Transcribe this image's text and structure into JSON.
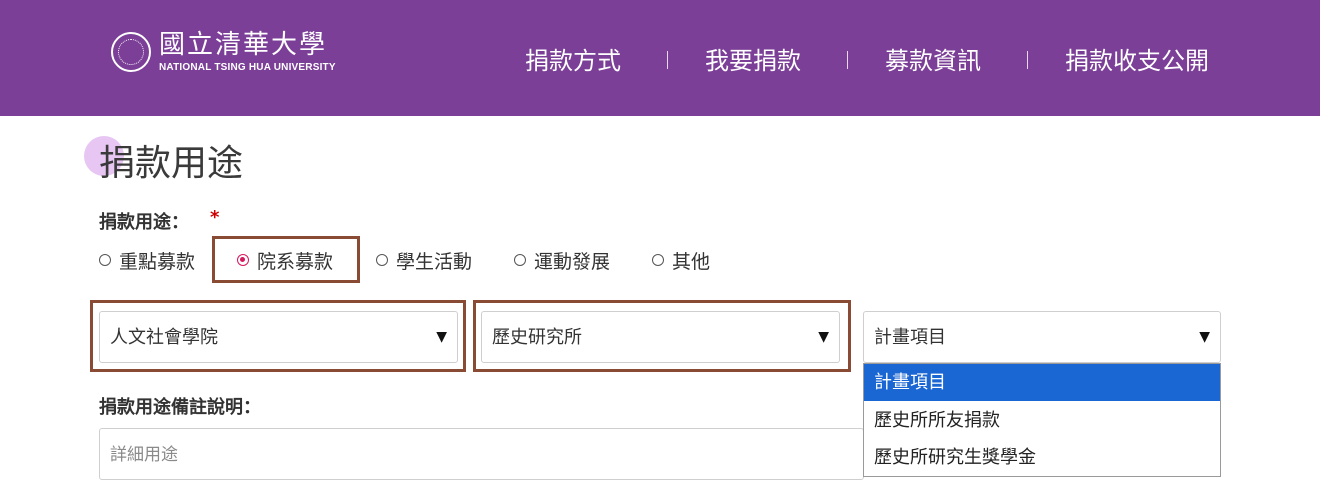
{
  "header": {
    "logo_cn": "國立清華大學",
    "logo_en": "NATIONAL TSING HUA UNIVERSITY",
    "bg_color": "#7b3f97",
    "nav": [
      {
        "label": "捐款方式"
      },
      {
        "label": "我要捐款"
      },
      {
        "label": "募款資訊"
      },
      {
        "label": "捐款收支公開"
      }
    ]
  },
  "main": {
    "title": "捐款用途",
    "purpose_label": "捐款用途：",
    "required_mark": "*",
    "radios": [
      {
        "label": "重點募款",
        "checked": false
      },
      {
        "label": "院系募款",
        "checked": true
      },
      {
        "label": "學生活動",
        "checked": false
      },
      {
        "label": "運動發展",
        "checked": false
      },
      {
        "label": "其他",
        "checked": false
      }
    ],
    "selects": {
      "college": {
        "value": "人文社會學院"
      },
      "department": {
        "value": "歷史研究所"
      },
      "project": {
        "value": "計畫項目",
        "options": [
          "計畫項目",
          "歷史所所友捐款",
          "歷史所研究生獎學金"
        ],
        "highlighted_index": 0
      }
    },
    "arrow_glyph": "▼",
    "remarks_label": "捐款用途備註說明：",
    "remarks_placeholder": "詳細用途",
    "accent_color": "#d6185c",
    "highlight_box_color": "#8a4b34",
    "dropdown_highlight_color": "#1a66d2"
  }
}
